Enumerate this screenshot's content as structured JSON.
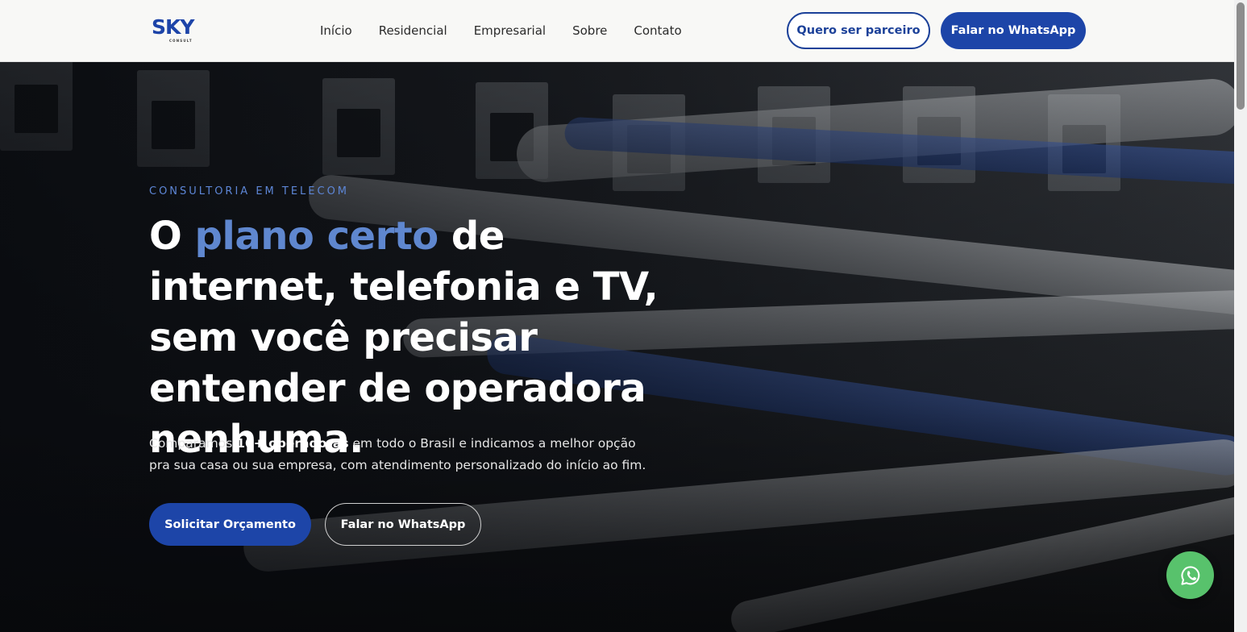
{
  "header": {
    "logo": {
      "brand": "SKY",
      "tagline": "CONSULT"
    },
    "nav": [
      {
        "label": "Início"
      },
      {
        "label": "Residencial"
      },
      {
        "label": "Empresarial"
      },
      {
        "label": "Sobre"
      },
      {
        "label": "Contato"
      }
    ],
    "partner_button": "Quero ser parceiro",
    "whatsapp_button": "Falar no WhatsApp"
  },
  "hero": {
    "eyebrow": "CONSULTORIA EM TELECOM",
    "headline": {
      "before": "O ",
      "accent": "plano certo",
      "after": " de internet, telefonia e TV, sem você precisar entender de operadora nenhuma."
    },
    "subtext": {
      "before": "Comparamos ",
      "bold": "10+ operadoras",
      "after": " em todo o Brasil e indicamos a melhor opção pra sua casa ou sua empresa, com atendimento personalizado do início ao fim."
    },
    "primary_button": "Solicitar Orçamento",
    "secondary_button": "Falar no WhatsApp"
  },
  "floating": {
    "icon": "whatsapp-icon"
  },
  "colors": {
    "brand_blue": "#1d45a8",
    "accent_blue": "#5f87cf",
    "whatsapp_green": "#58c26c"
  }
}
